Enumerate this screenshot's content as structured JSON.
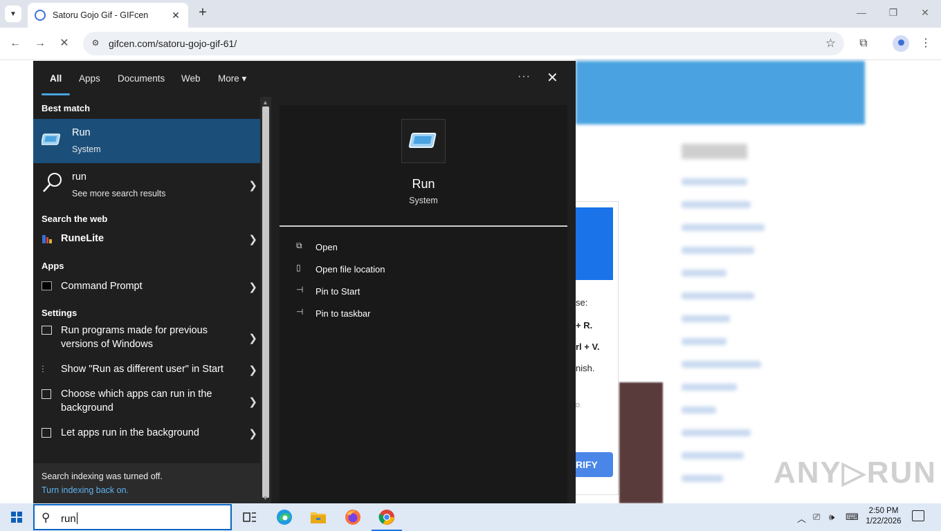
{
  "browser": {
    "tab_title": "Satoru Gojo Gif - GIFcen",
    "tab_close": "✕",
    "new_tab": "+",
    "url": "gifcen.com/satoru-gojo-gif-61/",
    "window_controls": {
      "minimize": "—",
      "restore": "❐",
      "close": "✕"
    },
    "nav": {
      "back": "←",
      "forward": "→",
      "stop": "✕"
    }
  },
  "webpage": {
    "captcha_lines": [
      "se:",
      "+ R.",
      "rl + V.",
      "nish.",
      "D:"
    ],
    "verify_label": "RIFY",
    "watermark": "ANY▷RUN"
  },
  "search_panel": {
    "tabs": [
      {
        "label": "All",
        "active": true
      },
      {
        "label": "Apps",
        "active": false
      },
      {
        "label": "Documents",
        "active": false
      },
      {
        "label": "Web",
        "active": false
      },
      {
        "label": "More",
        "active": false
      }
    ],
    "more_arrow": "▾",
    "options_glyph": "···",
    "close_glyph": "✕",
    "sections": {
      "best_match": "Best match",
      "search_web": "Search the web",
      "apps": "Apps",
      "settings": "Settings"
    },
    "best_match": {
      "title": "Run",
      "subtitle": "System"
    },
    "web_query": {
      "title": "run",
      "subtitle": "See more search results"
    },
    "web_results": [
      {
        "label": "RuneLite"
      }
    ],
    "apps": [
      {
        "label": "Command Prompt"
      }
    ],
    "settings": [
      {
        "line1": "Run programs made for previous",
        "line2": "versions of Windows"
      },
      {
        "line1": "Show \"Run as different user\" in Start",
        "line2": ""
      },
      {
        "line1": "Choose which apps can run in the",
        "line2": "background"
      },
      {
        "line1": "Let apps run in the background",
        "line2": ""
      }
    ],
    "chevron": "❯",
    "index_notice": {
      "text": "Search indexing was turned off.",
      "link": "Turn indexing back on."
    },
    "detail": {
      "name": "Run",
      "type": "System",
      "actions": [
        {
          "label": "Open",
          "icon": "open-icon"
        },
        {
          "label": "Open file location",
          "icon": "file-location-icon"
        },
        {
          "label": "Pin to Start",
          "icon": "pin-icon"
        },
        {
          "label": "Pin to taskbar",
          "icon": "pin-icon"
        }
      ]
    }
  },
  "taskbar": {
    "search_query": "run",
    "apps": [
      "task-view",
      "edge",
      "file-explorer",
      "firefox",
      "chrome"
    ],
    "time": "2:50 PM",
    "date": "1/22/2026"
  },
  "colors": {
    "panel_bg": "#1f1f1f",
    "selection": "#1b4f7a",
    "accent": "#4aa3e0",
    "taskbar_bg": "#dfe8f5"
  }
}
